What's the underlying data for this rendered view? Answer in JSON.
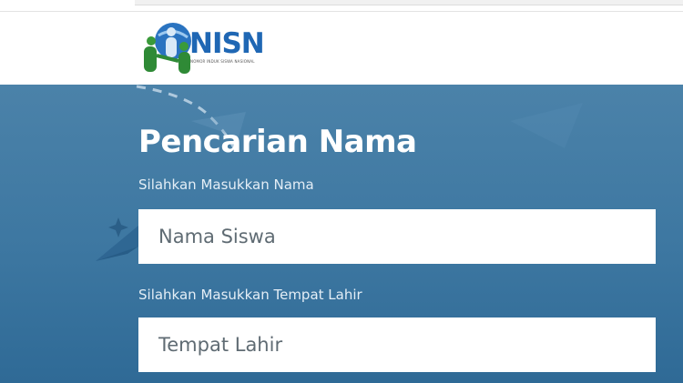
{
  "header": {
    "logo_text": "NISN",
    "logo_subtitle": "NOMOR INDUK SISWA NASIONAL",
    "logo_colors": {
      "blue": "#1f67b4",
      "green": "#3a9a3a"
    }
  },
  "search": {
    "title": "Pencarian Nama",
    "name_label": "Silahkan Masukkan Nama",
    "name_placeholder": "Nama Siswa",
    "place_label": "Silahkan Masukkan Tempat Lahir",
    "place_placeholder": "Tempat Lahir"
  },
  "theme": {
    "background": "#3f79a3",
    "input_background": "#ffffff"
  },
  "icons": [
    "nisn-logo-icon",
    "paper-plane-icon",
    "sparkle-icon"
  ]
}
